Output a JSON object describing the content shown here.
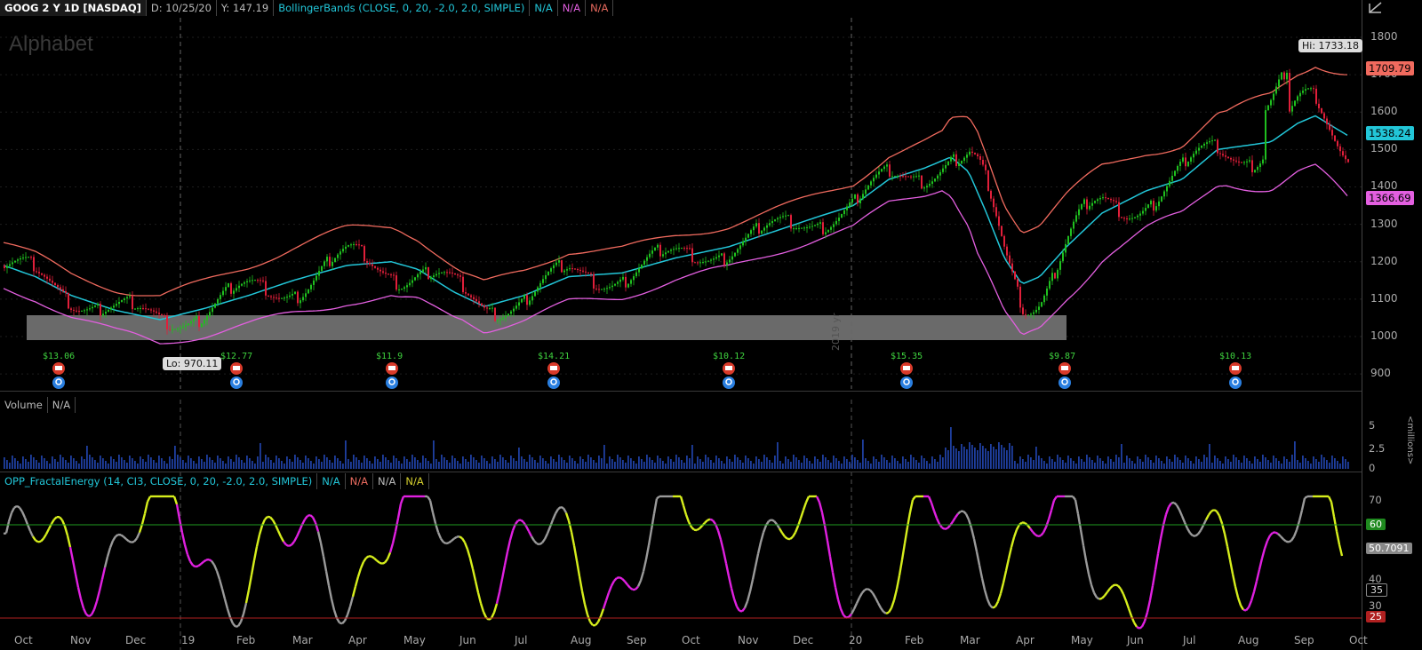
{
  "header": {
    "symbol": "GOOG 2 Y 1D [NASDAQ]",
    "date": "D: 10/25/20",
    "yvalue": "Y: 147.19",
    "study": "BollingerBands (CLOSE, 0, 20, -2.0, 2.0, SIMPLE)",
    "na1": "N/A",
    "na2": "N/A",
    "na3": "N/A"
  },
  "watermark": "Alphabet",
  "price_axis": {
    "ticks": [
      "1800",
      "1700",
      "1600",
      "1500",
      "1400",
      "1300",
      "1200",
      "1100",
      "1000",
      "900"
    ],
    "tag_upper": "1709.79",
    "tag_mid": "1538.24",
    "tag_lower": "1366.69",
    "upper_color": "#f06a5e",
    "mid_color": "#22c6d8",
    "lower_color": "#e35fe0"
  },
  "callouts": {
    "hi": "Hi: 1733.18",
    "lo": "Lo: 970.11",
    "year_marker": "2019 yr"
  },
  "earnings": [
    "$13.06",
    "$12.77",
    "$11.9",
    "$14.21",
    "$10.12",
    "$15.35",
    "$9.87",
    "$10.13"
  ],
  "volume": {
    "label": "Volume",
    "na": "N/A",
    "ticks": [
      "5",
      "2.5",
      "0"
    ],
    "unit": "<millions>"
  },
  "oscillator": {
    "study": "OPP_FractalEnergy (14, CI3, CLOSE, 0, 20, -2.0, 2.0, SIMPLE)",
    "na1": "N/A",
    "na2": "N/A",
    "na3": "N/A",
    "na4": "N/A",
    "ticks": [
      "70",
      "40",
      "30"
    ],
    "tag_60": "60",
    "tag_value": "50.7091",
    "tag_35": "35",
    "tag_25": "25"
  },
  "time_axis": [
    "Oct",
    "Nov",
    "Dec",
    "19",
    "Feb",
    "Mar",
    "Apr",
    "May",
    "Jun",
    "Jul",
    "Aug",
    "Sep",
    "Oct",
    "Nov",
    "Dec",
    "20",
    "Feb",
    "Mar",
    "Apr",
    "May",
    "Jun",
    "Jul",
    "Aug",
    "Sep",
    "Oct"
  ]
}
